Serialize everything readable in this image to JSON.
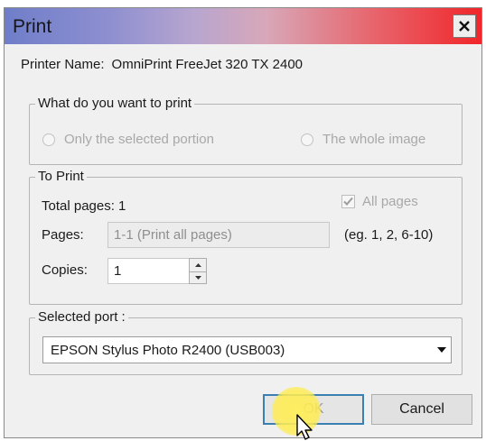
{
  "dialog": {
    "title": "Print",
    "close_symbol": "✕"
  },
  "printer": {
    "label": "Printer Name:",
    "value": "OmniPrint FreeJet 320 TX 2400"
  },
  "what_to_print": {
    "legend": "What do you want to print",
    "options": [
      {
        "label": "Only the selected portion",
        "selected": false,
        "enabled": false
      },
      {
        "label": "The whole image",
        "selected": false,
        "enabled": false
      }
    ]
  },
  "to_print": {
    "legend": "To Print",
    "total_pages_label": "Total pages: 1",
    "all_pages_label": "All pages",
    "all_pages_checked": true,
    "pages_label": "Pages:",
    "pages_value": "1-1 (Print all pages)",
    "pages_hint": "(eg. 1, 2, 6-10)",
    "copies_label": "Copies:",
    "copies_value": "1"
  },
  "port": {
    "legend": "Selected port :",
    "selected": "EPSON Stylus Photo R2400 (USB003)"
  },
  "buttons": {
    "ok": "OK",
    "cancel": "Cancel"
  },
  "icons": {
    "close": "close-icon",
    "dropdown": "chevron-down-icon",
    "spin_up": "spin-up-icon",
    "spin_down": "spin-down-icon",
    "checkmark": "checkmark-icon",
    "cursor": "mouse-pointer-icon"
  }
}
